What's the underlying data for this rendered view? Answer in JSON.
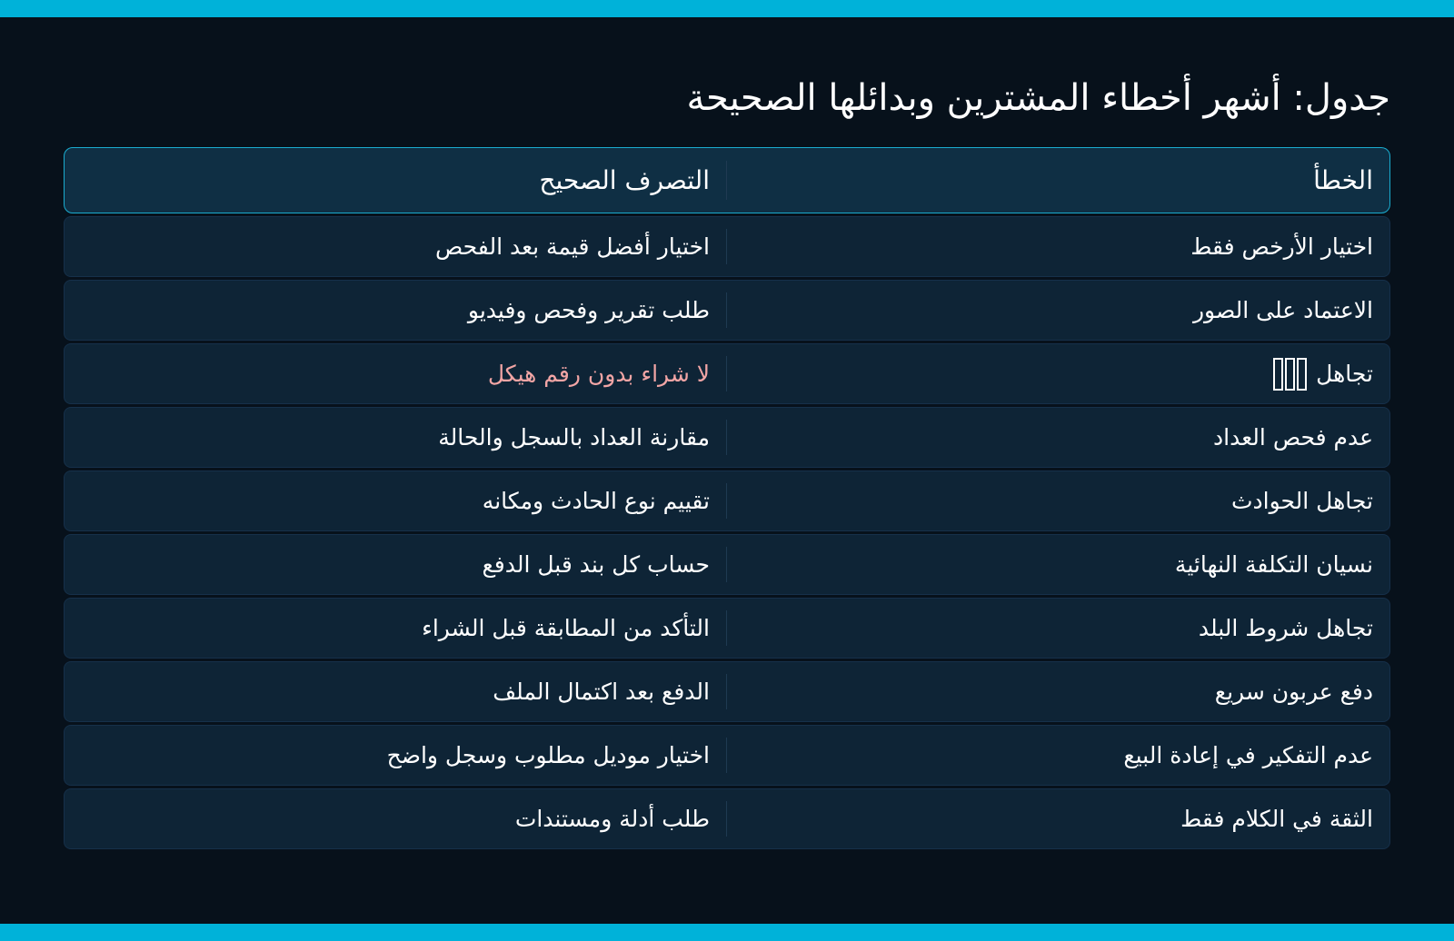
{
  "colors": {
    "accent": "#00b2d9",
    "background": "#07111b",
    "row_background": "#0e2436",
    "header_background": "#0f2f44",
    "warning_text": "#f2a5a5"
  },
  "title": "جدول: أشهر أخطاء المشترين وبدائلها الصحيحة",
  "table": {
    "headers": {
      "mistake": "الخطأ",
      "correct": "التصرف الصحيح"
    },
    "rows": [
      {
        "mistake": "اختيار الأرخص فقط",
        "correct": "اختيار أفضل قيمة بعد الفحص"
      },
      {
        "mistake": "الاعتماد على الصور",
        "correct": "طلب تقرير وفحص وفيديو"
      },
      {
        "mistake": "تجاهل",
        "correct": "لا شراء بدون رقم هيكل"
      },
      {
        "mistake": "عدم فحص العداد",
        "correct": "مقارنة العداد بالسجل والحالة"
      },
      {
        "mistake": "تجاهل الحوادث",
        "correct": "تقييم نوع الحادث ومكانه"
      },
      {
        "mistake": "نسيان التكلفة النهائية",
        "correct": "حساب كل بند قبل الدفع"
      },
      {
        "mistake": "تجاهل شروط البلد",
        "correct": "التأكد من المطابقة قبل الشراء"
      },
      {
        "mistake": "دفع عربون سريع",
        "correct": "الدفع بعد اكتمال الملف"
      },
      {
        "mistake": "عدم التفكير في إعادة البيع",
        "correct": "اختيار موديل مطلوب وسجل واضح"
      },
      {
        "mistake": "الثقة في الكلام فقط",
        "correct": "طلب أدلة ومستندات"
      }
    ]
  }
}
